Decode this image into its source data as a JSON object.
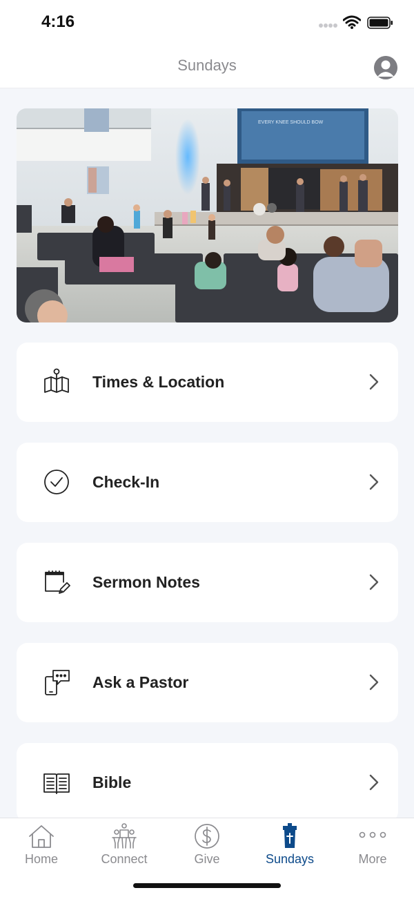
{
  "status_bar": {
    "time": "4:16"
  },
  "header": {
    "title": "Sundays"
  },
  "menu": {
    "items": [
      {
        "label": "Times & Location",
        "icon": "map-pin-icon"
      },
      {
        "label": "Check-In",
        "icon": "checkmark-circle-icon"
      },
      {
        "label": "Sermon Notes",
        "icon": "notepad-pencil-icon"
      },
      {
        "label": "Ask a Pastor",
        "icon": "phone-chat-icon"
      },
      {
        "label": "Bible",
        "icon": "open-book-icon"
      }
    ]
  },
  "tabbar": {
    "tabs": [
      {
        "label": "Home",
        "icon": "house-icon",
        "active": false
      },
      {
        "label": "Connect",
        "icon": "people-icon",
        "active": false
      },
      {
        "label": "Give",
        "icon": "dollar-circle-icon",
        "active": false
      },
      {
        "label": "Sundays",
        "icon": "pulpit-icon",
        "active": true
      },
      {
        "label": "More",
        "icon": "ellipsis-icon",
        "active": false
      }
    ]
  },
  "colors": {
    "accent": "#0d4a8a",
    "background": "#f4f6fa",
    "inactive": "#8a8a8e"
  }
}
